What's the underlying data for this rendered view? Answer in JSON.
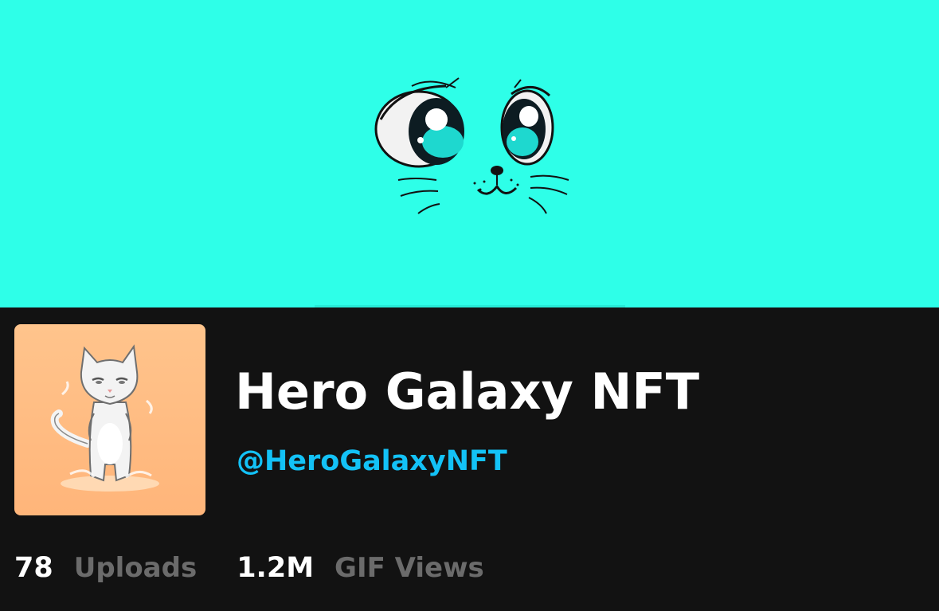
{
  "profile": {
    "display_name": "Hero Galaxy NFT",
    "handle": "@HeroGalaxyNFT"
  },
  "stats": [
    {
      "value": "78",
      "label": "Uploads"
    },
    {
      "value": "1.2M",
      "label": "GIF Views"
    }
  ],
  "colors": {
    "banner_background": "#2effe8",
    "page_background": "#121212",
    "handle_color": "#13c2f7",
    "name_color": "#ffffff",
    "stat_label_color": "#6b6b6b",
    "avatar_background": "#ffbf85"
  },
  "images": {
    "banner": "cat-eyes-banner",
    "avatar": "white-cat-avatar"
  }
}
